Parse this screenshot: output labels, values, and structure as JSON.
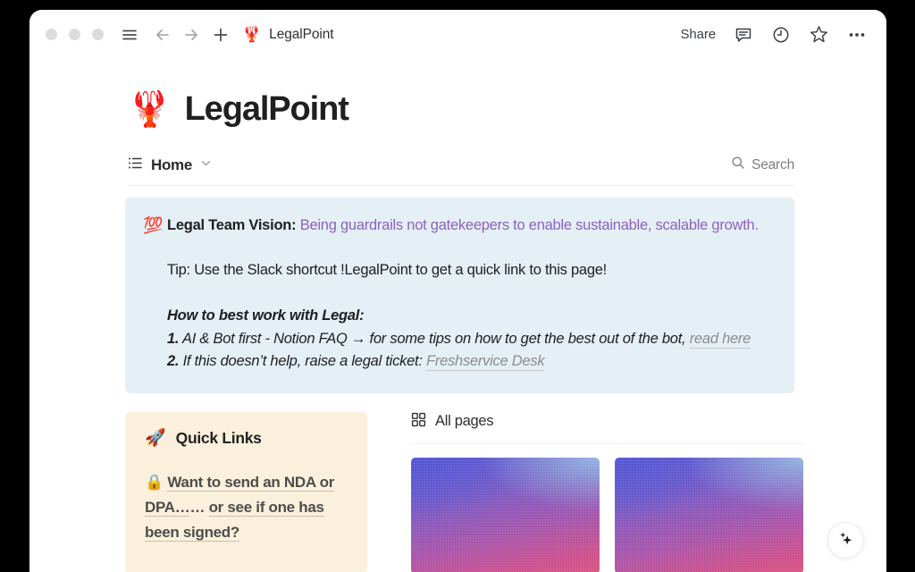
{
  "browser": {
    "window_controls": [
      "close",
      "minimize",
      "maximize"
    ],
    "menu_icon": "hamburger-icon",
    "back_icon": "arrow-left-icon",
    "forward_icon": "arrow-right-icon",
    "new_tab_icon": "plus-icon",
    "tab": {
      "favicon": "🦞",
      "title": "LegalPoint"
    },
    "actions": {
      "share_label": "Share",
      "comment_icon": "comment-icon",
      "history_icon": "clock-icon",
      "favorite_icon": "star-icon",
      "more_icon": "ellipsis-icon"
    }
  },
  "page": {
    "emoji": "🦞",
    "title": "LegalPoint",
    "tab_label": "Home",
    "tab_icon": "list-icon",
    "tab_chevron": "chevron-down-icon",
    "search": {
      "icon": "search-icon",
      "label": "Search"
    }
  },
  "callout": {
    "emoji": "💯",
    "vision_label": "Legal Team Vision:",
    "vision_text": " Being guardrails not gatekeepers to enable sustainable, scalable growth.",
    "vision_color": "#8e62bd",
    "background": "#e4eff6",
    "tip": "Tip: Use the Slack shortcut !LegalPoint to get a quick link to this page!",
    "howto_heading": "How to best work with Legal:",
    "items": [
      {
        "number": "1.",
        "text": " AI & Bot first - Notion FAQ → for some tips on how to get the best out of the bot, ",
        "link": "read here"
      },
      {
        "number": "2.",
        "text": " If this doesn’t help, raise a legal ticket: ",
        "link": "Freshservice Desk"
      }
    ]
  },
  "quick_links": {
    "emoji": "🚀",
    "title": "Quick Links",
    "background": "#fbf0db",
    "entries": [
      {
        "icon": "🔒",
        "label": "Want to send an NDA or DPA…"
      },
      {
        "separator": "…"
      },
      {
        "label": "or see if one has been signed?"
      }
    ]
  },
  "all_pages": {
    "icon": "grid-icon",
    "label": "All pages",
    "cards": [
      {
        "name": "page-card-1",
        "gradient": "#5a5ad3 → #a655ac → #dd5480"
      },
      {
        "name": "page-card-2",
        "gradient": "#5a5ad3 → #a655ac → #dd5480"
      }
    ]
  },
  "ai_button": {
    "icon": "sparkles-icon"
  }
}
